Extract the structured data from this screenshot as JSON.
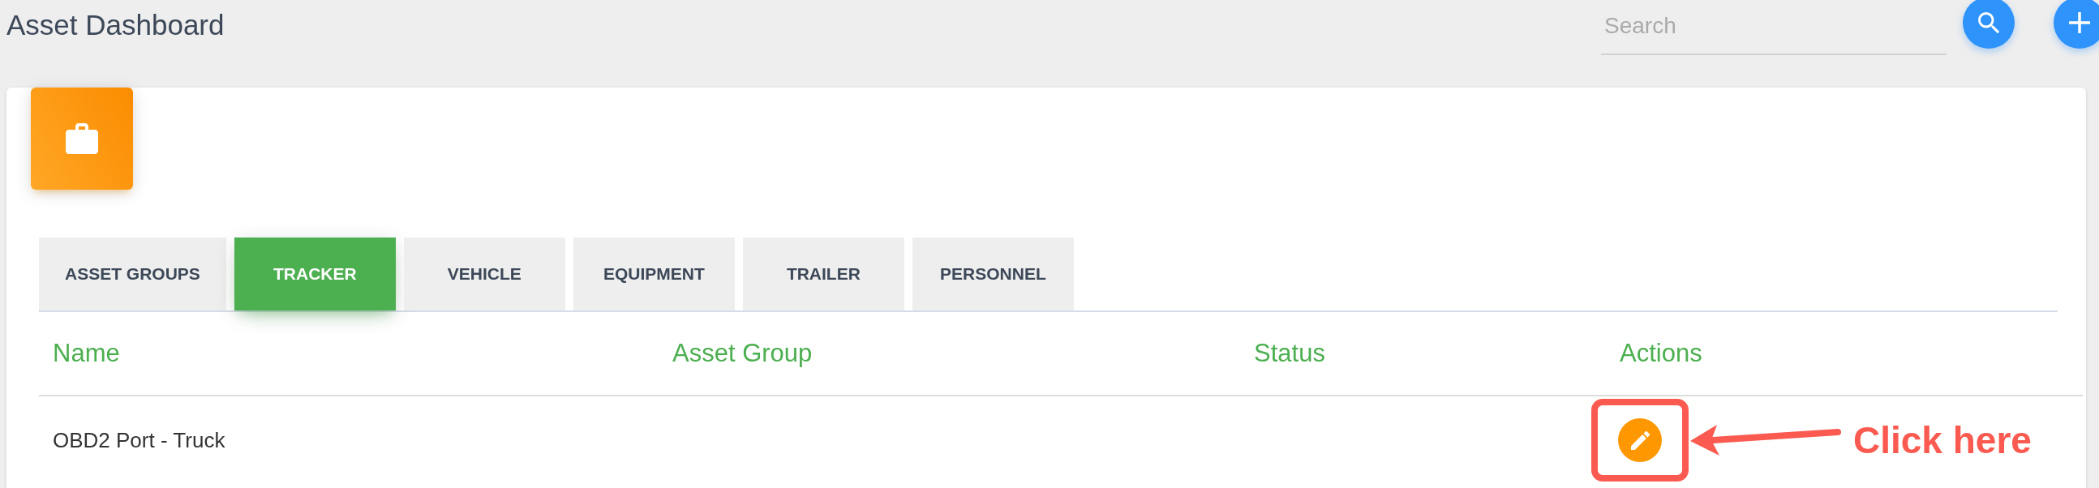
{
  "header": {
    "title": "Asset Dashboard",
    "search": {
      "placeholder": "Search"
    }
  },
  "tabs": [
    {
      "label": "ASSET GROUPS",
      "selected": false
    },
    {
      "label": "TRACKER",
      "selected": true
    },
    {
      "label": "VEHICLE",
      "selected": false
    },
    {
      "label": "EQUIPMENT",
      "selected": false
    },
    {
      "label": "TRAILER",
      "selected": false
    },
    {
      "label": "PERSONNEL",
      "selected": false
    }
  ],
  "table": {
    "columns": [
      "Name",
      "Asset Group",
      "Status",
      "Actions"
    ],
    "rows": [
      {
        "name": "OBD2 Port - Truck",
        "callout": {
          "label": "Click here"
        }
      }
    ]
  }
}
